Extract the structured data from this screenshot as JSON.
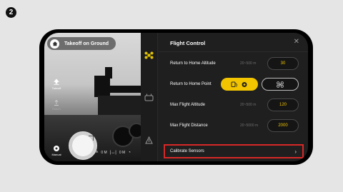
{
  "step_badge": "2",
  "camera": {
    "takeoff_label": "Takeoff on Ground",
    "side_buttons": [
      {
        "label": "Takeoff",
        "icon": "takeoff-icon",
        "dim": false
      },
      {
        "label": "Return",
        "icon": "return-home-icon",
        "dim": true
      },
      {
        "label": "Manual",
        "icon": "manual-icon",
        "dim": false
      }
    ],
    "telemetry": {
      "altitude": "0 M",
      "distance": "0 M"
    }
  },
  "panel": {
    "title": "Flight Control",
    "close": "✕",
    "rows": [
      {
        "label": "Return to Home Altitude",
        "range": "20~500 m",
        "value": "30"
      },
      {
        "label": "Return to Home Point",
        "options": [
          "aircraft-location",
          "controller-location"
        ]
      },
      {
        "label": "Max Flight Altitude",
        "range": "20~500 m",
        "value": "120"
      },
      {
        "label": "Max Flight Distance",
        "range": "20~5000 m",
        "value": "2000"
      }
    ],
    "calibrate": {
      "label": "Calibrate Sensors",
      "chevron": "›"
    }
  },
  "colors": {
    "accent": "#f2c500",
    "highlight_border": "#d62828"
  }
}
